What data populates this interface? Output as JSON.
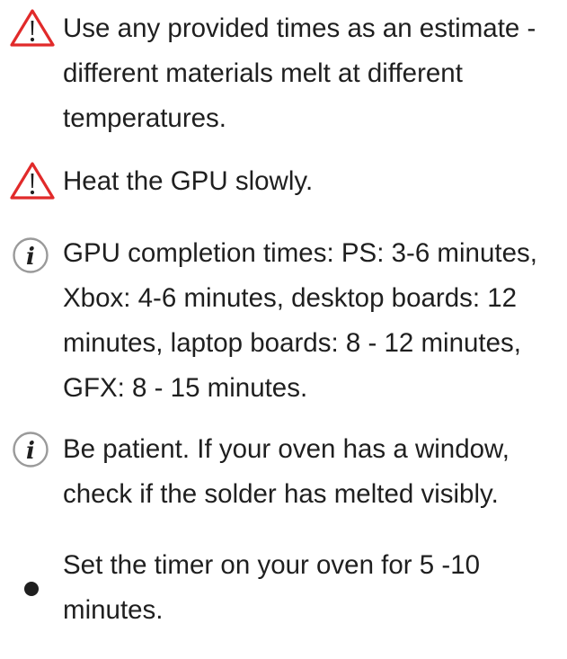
{
  "colors": {
    "caution": "#e12a2a",
    "note": "#9a9a9a",
    "bullet": "#1f1f1f",
    "text": "#1f1f1f"
  },
  "lines": [
    {
      "type": "caution",
      "icon": "warning-triangle-icon",
      "text": "Use any provided times as an estimate - different materials melt at different temperatures."
    },
    {
      "type": "caution",
      "icon": "warning-triangle-icon",
      "text": "Heat the GPU slowly."
    },
    {
      "type": "note",
      "icon": "info-circle-icon",
      "text": "GPU completion times: PS: 3-6 minutes, Xbox: 4-6 minutes, desktop boards: 12 minutes, laptop boards: 8 - 12 minutes, GFX: 8 - 15 minutes."
    },
    {
      "type": "note",
      "icon": "info-circle-icon",
      "text": "Be patient. If your oven has a window, check if the solder has melted visibly."
    },
    {
      "type": "bullet",
      "icon": "bullet-dot-icon",
      "text": "Set the timer on your oven for 5 -10 minutes."
    }
  ]
}
